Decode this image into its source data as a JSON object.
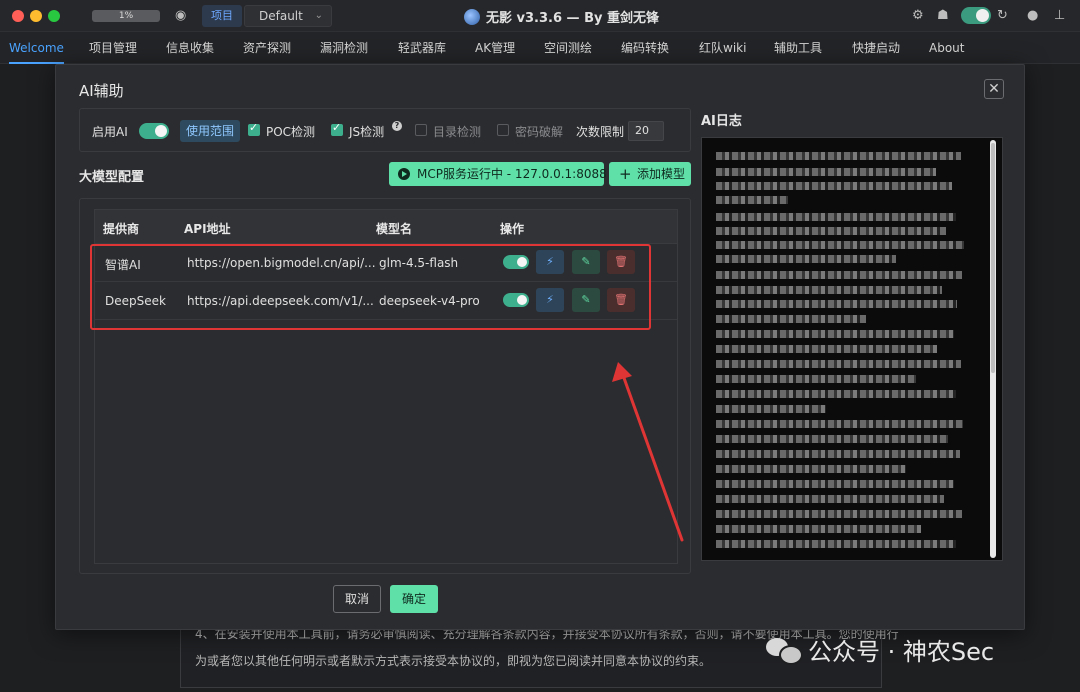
{
  "titlebar": {
    "progress": "1%",
    "project_label": "项目",
    "project_select": "Default",
    "app_title": "无影 v3.3.6 — By 重剑无锋"
  },
  "menu": [
    "Welcome",
    "项目管理",
    "信息收集",
    "资产探测",
    "漏洞检测",
    "轻武器库",
    "AK管理",
    "空间测绘",
    "编码转换",
    "红队wiki",
    "辅助工具",
    "快捷启动",
    "About"
  ],
  "modal": {
    "title": "AI辅助",
    "close": "✕",
    "enable_ai_label": "启用AI",
    "scope_button": "使用范围",
    "poc_label": "POC检测",
    "js_label": "JS检测",
    "help": "?",
    "dir_label": "目录检测",
    "pwd_label": "密码破解",
    "limit_label": "次数限制",
    "limit_value": "20",
    "section_title": "大模型配置",
    "mcp_button": "MCP服务运行中 - 127.0.0.1:8088",
    "add_model_button": "添加模型",
    "cancel": "取消",
    "confirm": "确定",
    "log_title": "AI日志"
  },
  "table": {
    "headers": [
      "提供商",
      "API地址",
      "模型名",
      "操作"
    ],
    "rows": [
      {
        "provider": "智谱AI",
        "api": "https://open.bigmodel.cn/api/...",
        "model": "glm-4.5-flash",
        "enabled": true
      },
      {
        "provider": "DeepSeek",
        "api": "https://api.deepseek.com/v1/...",
        "model": "deepseek-v4-pro",
        "enabled": true
      }
    ]
  },
  "background_doc": {
    "line1": "4、在安装并使用本工具前，请务必审慎阅读、充分理解各条款内容，并接受本协议所有条款，否则，请不要使用本工具。您的使用行",
    "line2": "为或者您以其他任何明示或者默示方式表示接受本协议的，即视为您已阅读并同意本协议的约束。"
  },
  "watermark": "公众号 · 神农Sec",
  "colors": {
    "accent": "#5fe0a9",
    "link": "#4aa3ff",
    "highlight": "#e03535"
  }
}
